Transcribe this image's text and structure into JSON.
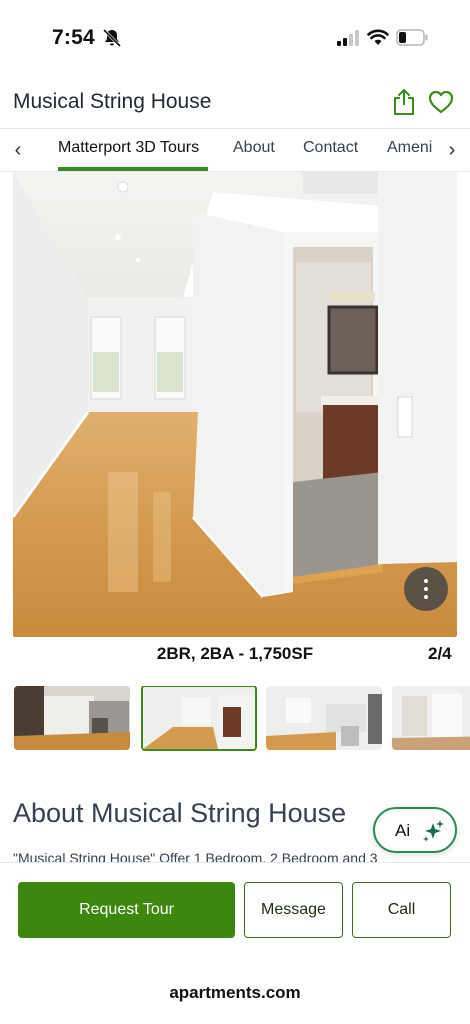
{
  "status_bar": {
    "time": "7:54",
    "icons": [
      "bell-slash-icon",
      "cellular-signal-icon",
      "wifi-icon",
      "battery-icon"
    ]
  },
  "header": {
    "title": "Musical String House",
    "icons": [
      "share-icon",
      "heart-icon"
    ],
    "accent_color": "#3b8a1a"
  },
  "tabs": {
    "items": [
      {
        "label": "Matterport 3D Tours",
        "active": true
      },
      {
        "label": "About",
        "active": false
      },
      {
        "label": "Contact",
        "active": false
      },
      {
        "label": "Ameni",
        "active": false
      }
    ],
    "prev_icon": "‹",
    "next_icon": "›"
  },
  "gallery": {
    "caption": "2BR, 2BA - 1,750SF",
    "counter": "2/4",
    "thumbnail_count": 4,
    "selected_thumbnail": 2
  },
  "about": {
    "heading": "About Musical String House",
    "text": "\"Musical String House\" Offer 1 Bedroom, 2 Bedroom and 3",
    "ai_label": "Ai"
  },
  "actions": {
    "request_tour": "Request Tour",
    "message": "Message",
    "call": "Call",
    "primary_color": "#3d8610"
  },
  "footer": {
    "brand": "apartments.com"
  }
}
